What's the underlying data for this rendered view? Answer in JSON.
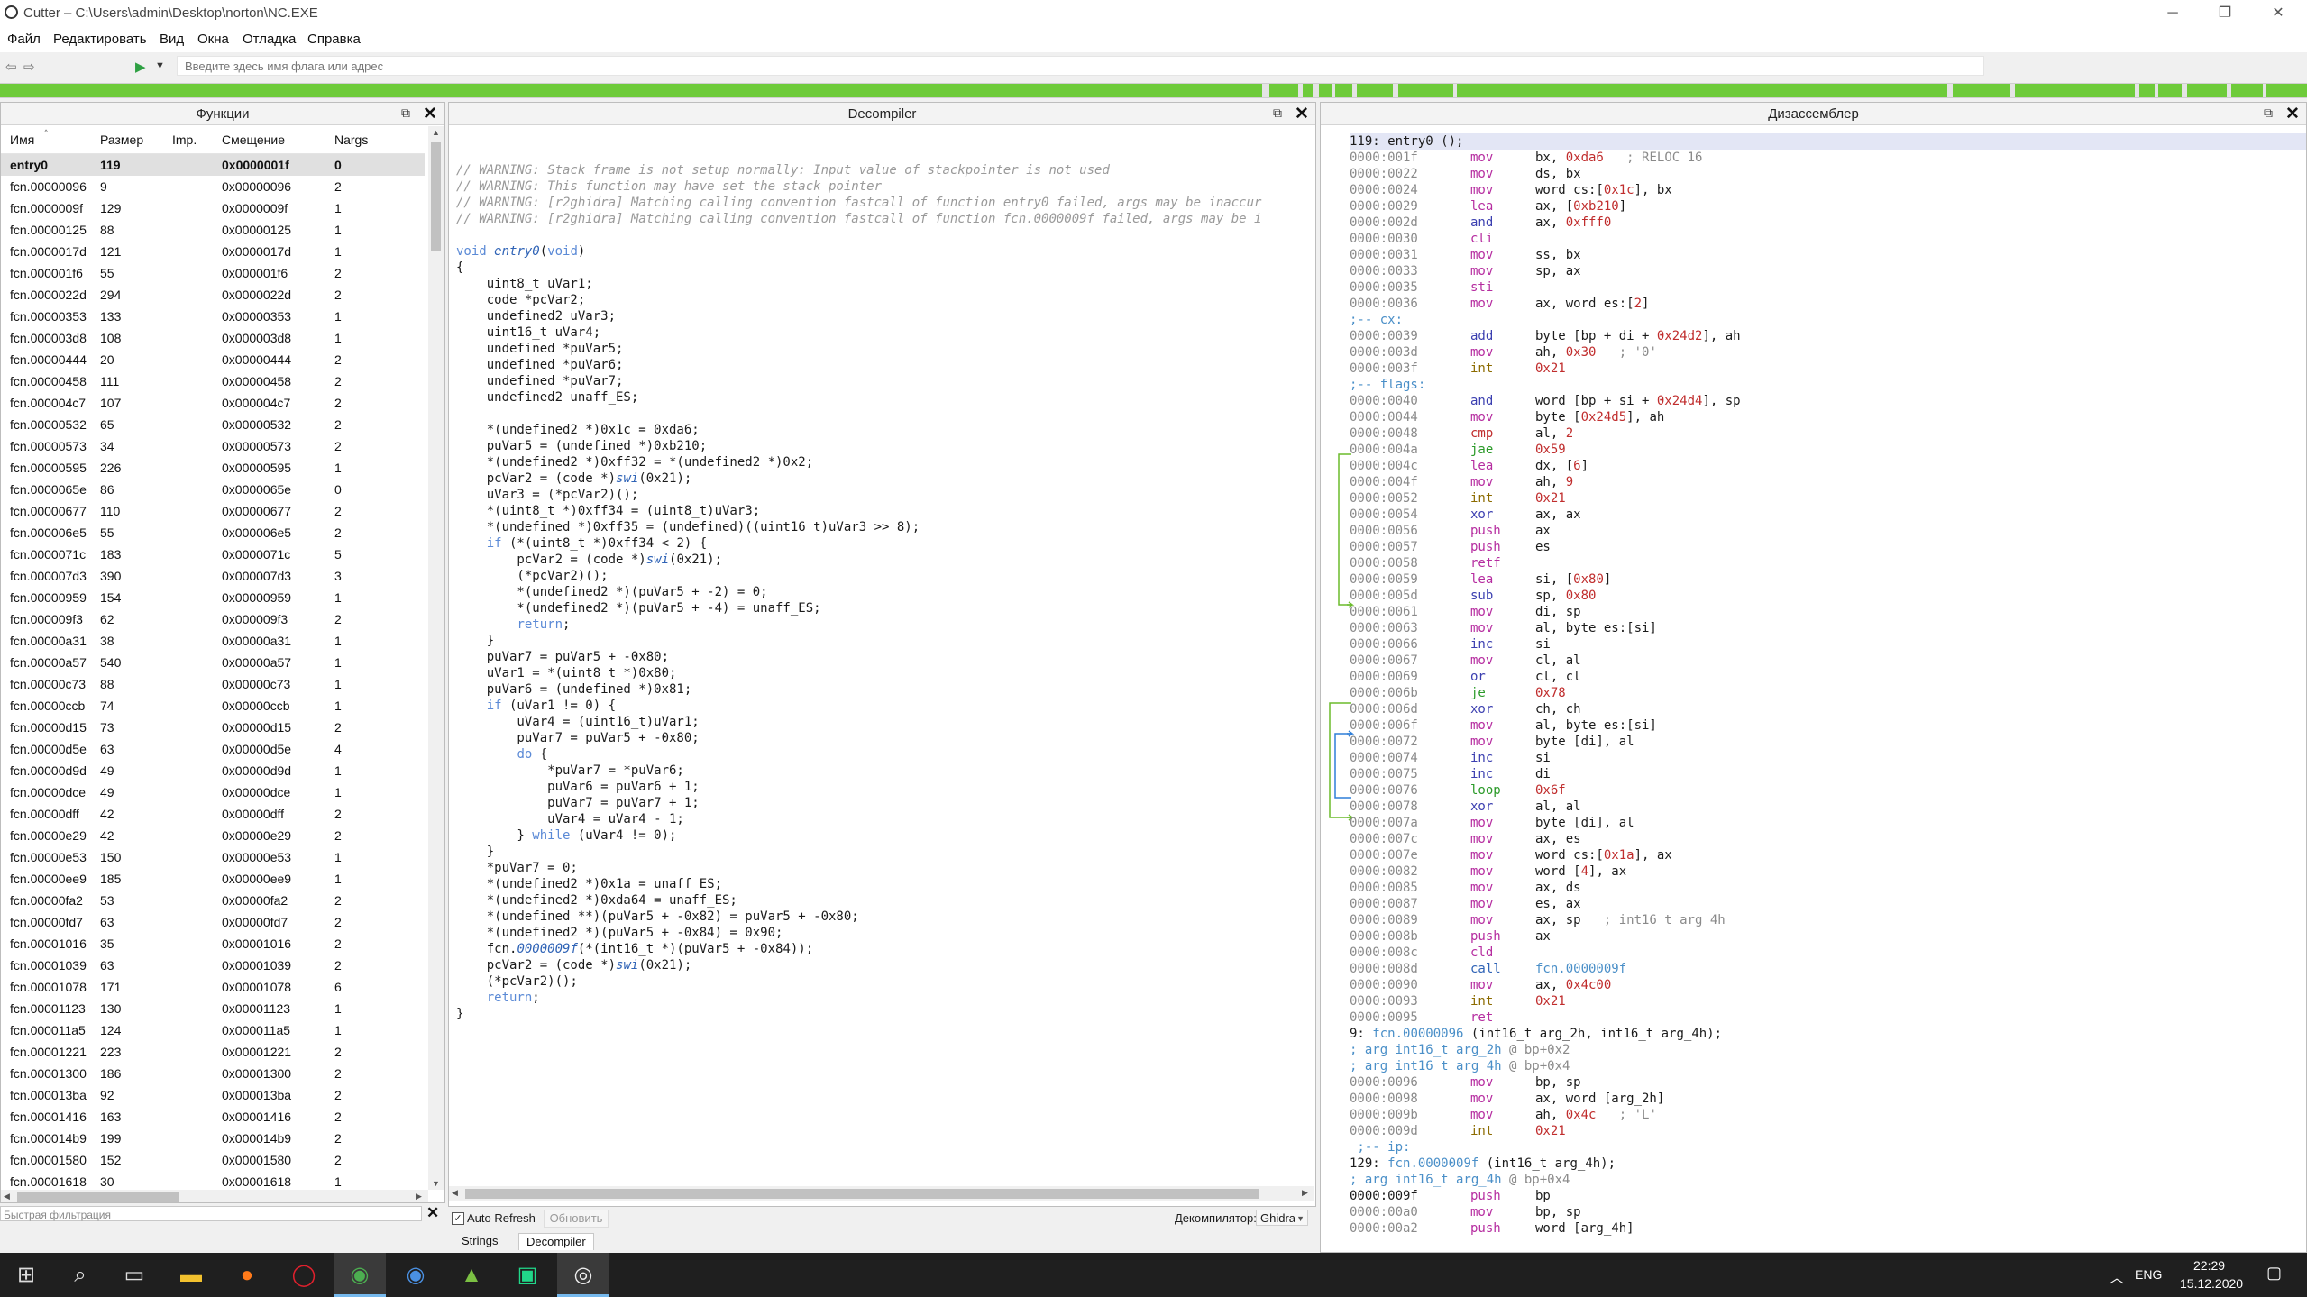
{
  "window": {
    "title": "Cutter – C:\\Users\\admin\\Desktop\\norton\\NC.EXE"
  },
  "menu": [
    "Файл",
    "Редактировать",
    "Вид",
    "Окна",
    "Отладка",
    "Справка"
  ],
  "toolbar": {
    "address_placeholder": "Введите здесь имя флага или адрес"
  },
  "functions": {
    "title": "Функции",
    "columns": [
      "Имя",
      "Размер",
      "Imp.",
      "Смещение",
      "Nargs"
    ],
    "rows": [
      [
        "entry0",
        "119",
        "",
        "0x0000001f",
        "0"
      ],
      [
        "fcn.00000096",
        "9",
        "",
        "0x00000096",
        "2"
      ],
      [
        "fcn.0000009f",
        "129",
        "",
        "0x0000009f",
        "1"
      ],
      [
        "fcn.00000125",
        "88",
        "",
        "0x00000125",
        "1"
      ],
      [
        "fcn.0000017d",
        "121",
        "",
        "0x0000017d",
        "1"
      ],
      [
        "fcn.000001f6",
        "55",
        "",
        "0x000001f6",
        "2"
      ],
      [
        "fcn.0000022d",
        "294",
        "",
        "0x0000022d",
        "2"
      ],
      [
        "fcn.00000353",
        "133",
        "",
        "0x00000353",
        "1"
      ],
      [
        "fcn.000003d8",
        "108",
        "",
        "0x000003d8",
        "1"
      ],
      [
        "fcn.00000444",
        "20",
        "",
        "0x00000444",
        "2"
      ],
      [
        "fcn.00000458",
        "111",
        "",
        "0x00000458",
        "2"
      ],
      [
        "fcn.000004c7",
        "107",
        "",
        "0x000004c7",
        "2"
      ],
      [
        "fcn.00000532",
        "65",
        "",
        "0x00000532",
        "2"
      ],
      [
        "fcn.00000573",
        "34",
        "",
        "0x00000573",
        "2"
      ],
      [
        "fcn.00000595",
        "226",
        "",
        "0x00000595",
        "1"
      ],
      [
        "fcn.0000065e",
        "86",
        "",
        "0x0000065e",
        "0"
      ],
      [
        "fcn.00000677",
        "110",
        "",
        "0x00000677",
        "2"
      ],
      [
        "fcn.000006e5",
        "55",
        "",
        "0x000006e5",
        "2"
      ],
      [
        "fcn.0000071c",
        "183",
        "",
        "0x0000071c",
        "5"
      ],
      [
        "fcn.000007d3",
        "390",
        "",
        "0x000007d3",
        "3"
      ],
      [
        "fcn.00000959",
        "154",
        "",
        "0x00000959",
        "1"
      ],
      [
        "fcn.000009f3",
        "62",
        "",
        "0x000009f3",
        "2"
      ],
      [
        "fcn.00000a31",
        "38",
        "",
        "0x00000a31",
        "1"
      ],
      [
        "fcn.00000a57",
        "540",
        "",
        "0x00000a57",
        "1"
      ],
      [
        "fcn.00000c73",
        "88",
        "",
        "0x00000c73",
        "1"
      ],
      [
        "fcn.00000ccb",
        "74",
        "",
        "0x00000ccb",
        "1"
      ],
      [
        "fcn.00000d15",
        "73",
        "",
        "0x00000d15",
        "2"
      ],
      [
        "fcn.00000d5e",
        "63",
        "",
        "0x00000d5e",
        "4"
      ],
      [
        "fcn.00000d9d",
        "49",
        "",
        "0x00000d9d",
        "1"
      ],
      [
        "fcn.00000dce",
        "49",
        "",
        "0x00000dce",
        "1"
      ],
      [
        "fcn.00000dff",
        "42",
        "",
        "0x00000dff",
        "2"
      ],
      [
        "fcn.00000e29",
        "42",
        "",
        "0x00000e29",
        "2"
      ],
      [
        "fcn.00000e53",
        "150",
        "",
        "0x00000e53",
        "1"
      ],
      [
        "fcn.00000ee9",
        "185",
        "",
        "0x00000ee9",
        "1"
      ],
      [
        "fcn.00000fa2",
        "53",
        "",
        "0x00000fa2",
        "2"
      ],
      [
        "fcn.00000fd7",
        "63",
        "",
        "0x00000fd7",
        "2"
      ],
      [
        "fcn.00001016",
        "35",
        "",
        "0x00001016",
        "2"
      ],
      [
        "fcn.00001039",
        "63",
        "",
        "0x00001039",
        "2"
      ],
      [
        "fcn.00001078",
        "171",
        "",
        "0x00001078",
        "6"
      ],
      [
        "fcn.00001123",
        "130",
        "",
        "0x00001123",
        "1"
      ],
      [
        "fcn.000011a5",
        "124",
        "",
        "0x000011a5",
        "1"
      ],
      [
        "fcn.00001221",
        "223",
        "",
        "0x00001221",
        "2"
      ],
      [
        "fcn.00001300",
        "186",
        "",
        "0x00001300",
        "2"
      ],
      [
        "fcn.000013ba",
        "92",
        "",
        "0x000013ba",
        "2"
      ],
      [
        "fcn.00001416",
        "163",
        "",
        "0x00001416",
        "2"
      ],
      [
        "fcn.000014b9",
        "199",
        "",
        "0x000014b9",
        "2"
      ],
      [
        "fcn.00001580",
        "152",
        "",
        "0x00001580",
        "2"
      ],
      [
        "fcn.00001618",
        "30",
        "",
        "0x00001618",
        "1"
      ]
    ],
    "filter_placeholder": "Быстрая фильтрация"
  },
  "decompiler": {
    "title": "Decompiler",
    "lines": [
      {
        "t": "// WARNING: Stack frame is not setup normally: Input value of stackpointer is not used",
        "k": "cm"
      },
      {
        "t": "// WARNING: This function may have set the stack pointer",
        "k": "cm"
      },
      {
        "t": "// WARNING: [r2ghidra] Matching calling convention fastcall of function entry0 failed, args may be inaccur",
        "k": "cm"
      },
      {
        "t": "// WARNING: [r2ghidra] Matching calling convention fastcall of function fcn.0000009f failed, args may be i",
        "k": "cm"
      },
      {
        "t": "",
        "k": ""
      },
      {
        "t": "void entry0(void)",
        "k": "sig"
      },
      {
        "t": "{",
        "k": ""
      },
      {
        "t": "    uint8_t uVar1;",
        "k": ""
      },
      {
        "t": "    code *pcVar2;",
        "k": ""
      },
      {
        "t": "    undefined2 uVar3;",
        "k": ""
      },
      {
        "t": "    uint16_t uVar4;",
        "k": ""
      },
      {
        "t": "    undefined *puVar5;",
        "k": ""
      },
      {
        "t": "    undefined *puVar6;",
        "k": ""
      },
      {
        "t": "    undefined *puVar7;",
        "k": ""
      },
      {
        "t": "    undefined2 unaff_ES;",
        "k": ""
      },
      {
        "t": "",
        "k": ""
      },
      {
        "t": "    *(undefined2 *)0x1c = 0xda6;",
        "k": ""
      },
      {
        "t": "    puVar5 = (undefined *)0xb210;",
        "k": ""
      },
      {
        "t": "    *(undefined2 *)0xff32 = *(undefined2 *)0x2;",
        "k": ""
      },
      {
        "t": "    pcVar2 = (code *)swi(0x21);",
        "k": "swi"
      },
      {
        "t": "    uVar3 = (*pcVar2)();",
        "k": ""
      },
      {
        "t": "    *(uint8_t *)0xff34 = (uint8_t)uVar3;",
        "k": ""
      },
      {
        "t": "    *(undefined *)0xff35 = (undefined)((uint16_t)uVar3 >> 8);",
        "k": ""
      },
      {
        "t": "    if (*(uint8_t *)0xff34 < 2) {",
        "k": "if"
      },
      {
        "t": "        pcVar2 = (code *)swi(0x21);",
        "k": "swi"
      },
      {
        "t": "        (*pcVar2)();",
        "k": ""
      },
      {
        "t": "        *(undefined2 *)(puVar5 + -2) = 0;",
        "k": ""
      },
      {
        "t": "        *(undefined2 *)(puVar5 + -4) = unaff_ES;",
        "k": ""
      },
      {
        "t": "        return;",
        "k": "ret"
      },
      {
        "t": "    }",
        "k": ""
      },
      {
        "t": "    puVar7 = puVar5 + -0x80;",
        "k": ""
      },
      {
        "t": "    uVar1 = *(uint8_t *)0x80;",
        "k": ""
      },
      {
        "t": "    puVar6 = (undefined *)0x81;",
        "k": ""
      },
      {
        "t": "    if (uVar1 != 0) {",
        "k": "if"
      },
      {
        "t": "        uVar4 = (uint16_t)uVar1;",
        "k": ""
      },
      {
        "t": "        puVar7 = puVar5 + -0x80;",
        "k": ""
      },
      {
        "t": "        do {",
        "k": "do"
      },
      {
        "t": "            *puVar7 = *puVar6;",
        "k": ""
      },
      {
        "t": "            puVar6 = puVar6 + 1;",
        "k": ""
      },
      {
        "t": "            puVar7 = puVar7 + 1;",
        "k": ""
      },
      {
        "t": "            uVar4 = uVar4 - 1;",
        "k": ""
      },
      {
        "t": "        } while (uVar4 != 0);",
        "k": "while"
      },
      {
        "t": "    }",
        "k": ""
      },
      {
        "t": "    *puVar7 = 0;",
        "k": ""
      },
      {
        "t": "    *(undefined2 *)0x1a = unaff_ES;",
        "k": ""
      },
      {
        "t": "    *(undefined2 *)0xda64 = unaff_ES;",
        "k": ""
      },
      {
        "t": "    *(undefined **)(puVar5 + -0x82) = puVar5 + -0x80;",
        "k": ""
      },
      {
        "t": "    *(undefined2 *)(puVar5 + -0x84) = 0x90;",
        "k": ""
      },
      {
        "t": "    fcn.0000009f(*(int16_t *)(puVar5 + -0x84));",
        "k": "call"
      },
      {
        "t": "    pcVar2 = (code *)swi(0x21);",
        "k": "swi"
      },
      {
        "t": "    (*pcVar2)();",
        "k": ""
      },
      {
        "t": "    return;",
        "k": "ret"
      },
      {
        "t": "}",
        "k": ""
      }
    ],
    "auto_refresh_label": "Auto Refresh",
    "refresh_button": "Обновить",
    "decompiler_label": "Декомпилятор:",
    "decompiler_value": "Ghidra",
    "tabs": [
      "Strings",
      "Decompiler"
    ]
  },
  "disassembly": {
    "title": "Дизассемблер",
    "lines": [
      {
        "type": "fn",
        "text": "119: entry0 ();"
      },
      {
        "type": "ins",
        "addr": "0000:001f",
        "mn": "mov",
        "op": "bx, 0xda6",
        "cmt": "; RELOC 16",
        "cls": "mov"
      },
      {
        "type": "ins",
        "addr": "0000:0022",
        "mn": "mov",
        "op": "ds, bx",
        "cls": "mov"
      },
      {
        "type": "ins",
        "addr": "0000:0024",
        "mn": "mov",
        "op": "word cs:[0x1c], bx",
        "cls": "mov"
      },
      {
        "type": "ins",
        "addr": "0000:0029",
        "mn": "lea",
        "op": "ax, [0xb210]",
        "cls": "mov"
      },
      {
        "type": "ins",
        "addr": "0000:002d",
        "mn": "and",
        "op": "ax, 0xfff0",
        "cls": "log"
      },
      {
        "type": "ins",
        "addr": "0000:0030",
        "mn": "cli",
        "op": "",
        "cls": "push"
      },
      {
        "type": "ins",
        "addr": "0000:0031",
        "mn": "mov",
        "op": "ss, bx",
        "cls": "mov"
      },
      {
        "type": "ins",
        "addr": "0000:0033",
        "mn": "mov",
        "op": "sp, ax",
        "cls": "mov"
      },
      {
        "type": "ins",
        "addr": "0000:0035",
        "mn": "sti",
        "op": "",
        "cls": "push"
      },
      {
        "type": "ins",
        "addr": "0000:0036",
        "mn": "mov",
        "op": "ax, word es:[2]",
        "cls": "mov"
      },
      {
        "type": "lbl",
        "text": ";-- cx:"
      },
      {
        "type": "ins",
        "addr": "0000:0039",
        "mn": "add",
        "op": "byte [bp + di + 0x24d2], ah",
        "cls": "log"
      },
      {
        "type": "ins",
        "addr": "0000:003d",
        "mn": "mov",
        "op": "ah, 0x30",
        "cmt": "; '0'",
        "cls": "mov"
      },
      {
        "type": "ins",
        "addr": "0000:003f",
        "mn": "int",
        "op": "0x21",
        "cls": "int"
      },
      {
        "type": "lbl",
        "text": ";-- flags:"
      },
      {
        "type": "ins",
        "addr": "0000:0040",
        "mn": "and",
        "op": "word [bp + si + 0x24d4], sp",
        "cls": "log"
      },
      {
        "type": "ins",
        "addr": "0000:0044",
        "mn": "mov",
        "op": "byte [0x24d5], ah",
        "cls": "mov"
      },
      {
        "type": "ins",
        "addr": "0000:0048",
        "mn": "cmp",
        "op": "al, 2",
        "cls": "cmp"
      },
      {
        "type": "ins",
        "addr": "0000:004a",
        "mn": "jae",
        "op": "0x59",
        "cls": "jmp"
      },
      {
        "type": "ins",
        "addr": "0000:004c",
        "mn": "lea",
        "op": "dx, [6]",
        "cls": "mov"
      },
      {
        "type": "ins",
        "addr": "0000:004f",
        "mn": "mov",
        "op": "ah, 9",
        "cls": "mov"
      },
      {
        "type": "ins",
        "addr": "0000:0052",
        "mn": "int",
        "op": "0x21",
        "cls": "int"
      },
      {
        "type": "ins",
        "addr": "0000:0054",
        "mn": "xor",
        "op": "ax, ax",
        "cls": "log"
      },
      {
        "type": "ins",
        "addr": "0000:0056",
        "mn": "push",
        "op": "ax",
        "cls": "push"
      },
      {
        "type": "ins",
        "addr": "0000:0057",
        "mn": "push",
        "op": "es",
        "cls": "push"
      },
      {
        "type": "ins",
        "addr": "0000:0058",
        "mn": "retf",
        "op": "",
        "cls": "push"
      },
      {
        "type": "ins",
        "addr": "0000:0059",
        "mn": "lea",
        "op": "si, [0x80]",
        "cls": "mov"
      },
      {
        "type": "ins",
        "addr": "0000:005d",
        "mn": "sub",
        "op": "sp, 0x80",
        "cls": "log"
      },
      {
        "type": "ins",
        "addr": "0000:0061",
        "mn": "mov",
        "op": "di, sp",
        "cls": "mov"
      },
      {
        "type": "ins",
        "addr": "0000:0063",
        "mn": "mov",
        "op": "al, byte es:[si]",
        "cls": "mov"
      },
      {
        "type": "ins",
        "addr": "0000:0066",
        "mn": "inc",
        "op": "si",
        "cls": "log"
      },
      {
        "type": "ins",
        "addr": "0000:0067",
        "mn": "mov",
        "op": "cl, al",
        "cls": "mov"
      },
      {
        "type": "ins",
        "addr": "0000:0069",
        "mn": "or",
        "op": "cl, cl",
        "cls": "log"
      },
      {
        "type": "ins",
        "addr": "0000:006b",
        "mn": "je",
        "op": "0x78",
        "cls": "jmp"
      },
      {
        "type": "ins",
        "addr": "0000:006d",
        "mn": "xor",
        "op": "ch, ch",
        "cls": "log"
      },
      {
        "type": "ins",
        "addr": "0000:006f",
        "mn": "mov",
        "op": "al, byte es:[si]",
        "cls": "mov"
      },
      {
        "type": "ins",
        "addr": "0000:0072",
        "mn": "mov",
        "op": "byte [di], al",
        "cls": "mov"
      },
      {
        "type": "ins",
        "addr": "0000:0074",
        "mn": "inc",
        "op": "si",
        "cls": "log"
      },
      {
        "type": "ins",
        "addr": "0000:0075",
        "mn": "inc",
        "op": "di",
        "cls": "log"
      },
      {
        "type": "ins",
        "addr": "0000:0076",
        "mn": "loop",
        "op": "0x6f",
        "cls": "jmp"
      },
      {
        "type": "ins",
        "addr": "0000:0078",
        "mn": "xor",
        "op": "al, al",
        "cls": "log"
      },
      {
        "type": "ins",
        "addr": "0000:007a",
        "mn": "mov",
        "op": "byte [di], al",
        "cls": "mov"
      },
      {
        "type": "ins",
        "addr": "0000:007c",
        "mn": "mov",
        "op": "ax, es",
        "cls": "mov"
      },
      {
        "type": "ins",
        "addr": "0000:007e",
        "mn": "mov",
        "op": "word cs:[0x1a], ax",
        "cls": "mov"
      },
      {
        "type": "ins",
        "addr": "0000:0082",
        "mn": "mov",
        "op": "word [4], ax",
        "cls": "mov"
      },
      {
        "type": "ins",
        "addr": "0000:0085",
        "mn": "mov",
        "op": "ax, ds",
        "cls": "mov"
      },
      {
        "type": "ins",
        "addr": "0000:0087",
        "mn": "mov",
        "op": "es, ax",
        "cls": "mov"
      },
      {
        "type": "ins",
        "addr": "0000:0089",
        "mn": "mov",
        "op": "ax, sp",
        "cmt": "; int16_t arg_4h",
        "cls": "mov"
      },
      {
        "type": "ins",
        "addr": "0000:008b",
        "mn": "push",
        "op": "ax",
        "cls": "push"
      },
      {
        "type": "ins",
        "addr": "0000:008c",
        "mn": "cld",
        "op": "",
        "cls": "push"
      },
      {
        "type": "ins",
        "addr": "0000:008d",
        "mn": "call",
        "op": "fcn.0000009f",
        "cls": "call"
      },
      {
        "type": "ins",
        "addr": "0000:0090",
        "mn": "mov",
        "op": "ax, 0x4c00",
        "cls": "mov"
      },
      {
        "type": "ins",
        "addr": "0000:0093",
        "mn": "int",
        "op": "0x21",
        "cls": "int"
      },
      {
        "type": "ins",
        "addr": "0000:0095",
        "mn": "ret",
        "op": "",
        "cls": "push"
      },
      {
        "type": "fn",
        "text": "9: fcn.00000096 (int16_t arg_2h, int16_t arg_4h);"
      },
      {
        "type": "arg",
        "text": "; arg int16_t arg_2h @ bp+0x2"
      },
      {
        "type": "arg",
        "text": "; arg int16_t arg_4h @ bp+0x4"
      },
      {
        "type": "ins",
        "addr": "0000:0096",
        "mn": "mov",
        "op": "bp, sp",
        "cls": "mov"
      },
      {
        "type": "ins",
        "addr": "0000:0098",
        "mn": "mov",
        "op": "ax, word [arg_2h]",
        "cls": "mov"
      },
      {
        "type": "ins",
        "addr": "0000:009b",
        "mn": "mov",
        "op": "ah, 0x4c",
        "cmt": "; 'L'",
        "cls": "mov"
      },
      {
        "type": "ins",
        "addr": "0000:009d",
        "mn": "int",
        "op": "0x21",
        "cls": "int"
      },
      {
        "type": "lbl",
        "text": " ;-- ip:"
      },
      {
        "type": "fn",
        "text": "129: fcn.0000009f (int16_t arg_4h);"
      },
      {
        "type": "arg",
        "text": "; arg int16_t arg_4h @ bp+0x4"
      },
      {
        "type": "ins",
        "addr": "0000:009f",
        "mn": "push",
        "op": "bp",
        "cls": "push",
        "cur": true
      },
      {
        "type": "ins",
        "addr": "0000:00a0",
        "mn": "mov",
        "op": "bp, sp",
        "cls": "mov"
      },
      {
        "type": "ins",
        "addr": "0000:00a2",
        "mn": "push",
        "op": "word [arg_4h]",
        "cls": "push"
      }
    ]
  },
  "taskbar": {
    "lang": "ENG",
    "time": "22:29",
    "date": "15.12.2020"
  }
}
